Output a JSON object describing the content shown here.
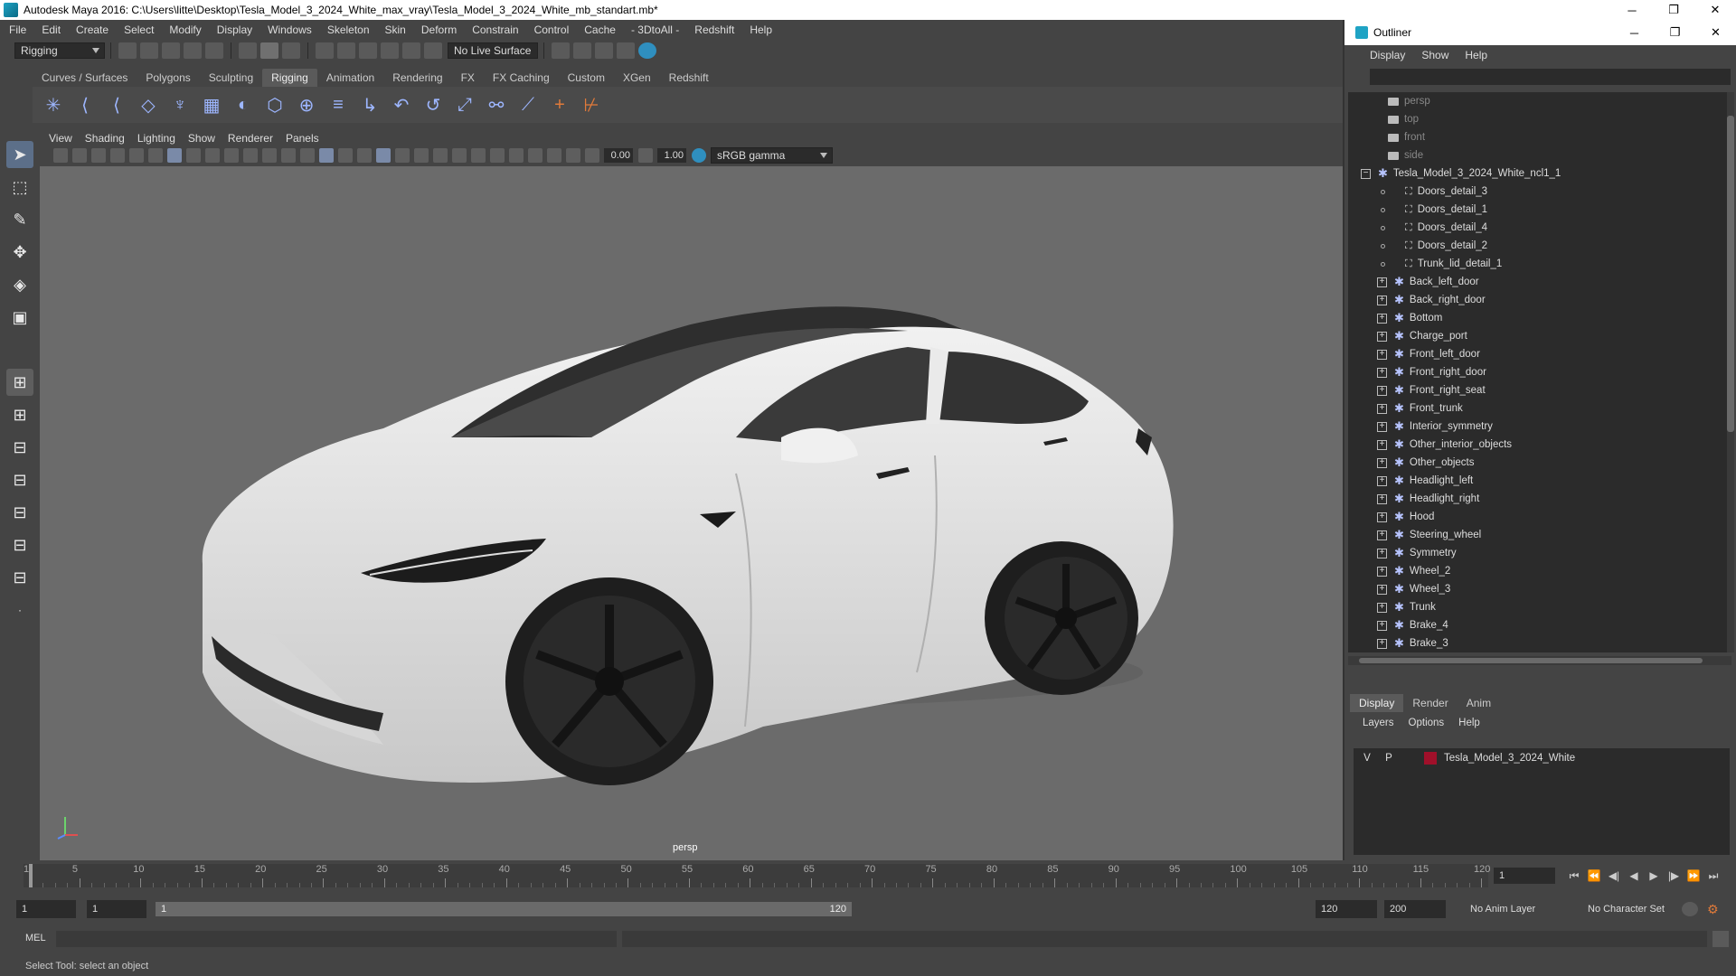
{
  "window": {
    "title": "Autodesk Maya 2016: C:\\Users\\litte\\Desktop\\Tesla_Model_3_2024_White_max_vray\\Tesla_Model_3_2024_White_mb_standart.mb*",
    "minimize": "─",
    "restore": "❐",
    "close": "✕"
  },
  "menu": [
    "File",
    "Edit",
    "Create",
    "Select",
    "Modify",
    "Display",
    "Windows",
    "Skeleton",
    "Skin",
    "Deform",
    "Constrain",
    "Control",
    "Cache",
    "- 3DtoAll -",
    "Redshift",
    "Help"
  ],
  "statusline": {
    "mode": "Rigging",
    "live_surface": "No Live Surface"
  },
  "shelf_tabs": [
    "Curves / Surfaces",
    "Polygons",
    "Sculpting",
    "Rigging",
    "Animation",
    "Rendering",
    "FX",
    "FX Caching",
    "Custom",
    "XGen",
    "Redshift"
  ],
  "active_shelf_tab": "Rigging",
  "viewport": {
    "menu": [
      "View",
      "Shading",
      "Lighting",
      "Show",
      "Renderer",
      "Panels"
    ],
    "exposure": "0.00",
    "gamma": "1.00",
    "colorspace": "sRGB gamma",
    "camera_label": "persp"
  },
  "outliner": {
    "title": "Outliner",
    "menu": [
      "Display",
      "Show",
      "Help"
    ],
    "cameras": [
      "persp",
      "top",
      "front",
      "side"
    ],
    "root": "Tesla_Model_3_2024_White_ncl1_1",
    "mesh_children": [
      "Doors_detail_3",
      "Doors_detail_1",
      "Doors_detail_4",
      "Doors_detail_2",
      "Trunk_lid_detail_1"
    ],
    "group_children": [
      "Back_left_door",
      "Back_right_door",
      "Bottom",
      "Charge_port",
      "Front_left_door",
      "Front_right_door",
      "Front_right_seat",
      "Front_trunk",
      "Interior_symmetry",
      "Other_interior_objects",
      "Other_objects",
      "Headlight_left",
      "Headlight_right",
      "Hood",
      "Steering_wheel",
      "Symmetry",
      "Wheel_2",
      "Wheel_3",
      "Trunk",
      "Brake_4",
      "Brake_3"
    ]
  },
  "layers": {
    "tabs": [
      "Display",
      "Render",
      "Anim"
    ],
    "active_tab": "Display",
    "menu": [
      "Layers",
      "Options",
      "Help"
    ],
    "rows": [
      {
        "v": "V",
        "p": "P",
        "name": "Tesla_Model_3_2024_White",
        "color": "#a0102a"
      }
    ]
  },
  "timeline": {
    "ticks": [
      1,
      5,
      10,
      15,
      20,
      25,
      30,
      35,
      40,
      45,
      50,
      55,
      60,
      65,
      70,
      75,
      80,
      85,
      90,
      95,
      100,
      105,
      110,
      115,
      120
    ],
    "current_frame": "1"
  },
  "range": {
    "start": "1",
    "playback_start": "1",
    "bar_start": "1",
    "bar_end": "120",
    "playback_end": "120",
    "end": "200",
    "anim_layer": "No Anim Layer",
    "character_set": "No Character Set"
  },
  "cmdline": {
    "label": "MEL"
  },
  "helpline": "Select Tool: select an object",
  "colors": {
    "car_body": "#e8e8e8",
    "active_tool": "#5c6f89",
    "layer_color": "#a0102a"
  }
}
